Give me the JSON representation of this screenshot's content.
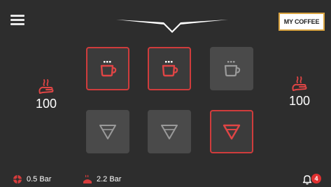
{
  "header": {
    "my_coffee_label": "MY COFFEE"
  },
  "left_panel": {
    "icon": "steam-hand-icon",
    "value": "100"
  },
  "right_panel": {
    "icon": "steam-hand-icon",
    "value": "100"
  },
  "tiles": [
    {
      "icon": "coffee-cup-icon",
      "state": "active"
    },
    {
      "icon": "coffee-cup-icon",
      "state": "active"
    },
    {
      "icon": "coffee-cup-icon",
      "state": "inactive"
    },
    {
      "icon": "filter-cone-icon",
      "state": "inactive"
    },
    {
      "icon": "filter-cone-icon",
      "state": "inactive"
    },
    {
      "icon": "filter-cone-icon",
      "state": "active"
    }
  ],
  "status_bar": {
    "pressure_1": "0.5 Bar",
    "pressure_2": "2.2 Bar",
    "notification_count": "4"
  },
  "colors": {
    "background": "#2d2d2d",
    "accent_red": "#d03c3c",
    "inactive_tile": "#4a4a4a",
    "highlight_border": "#d9a441"
  }
}
